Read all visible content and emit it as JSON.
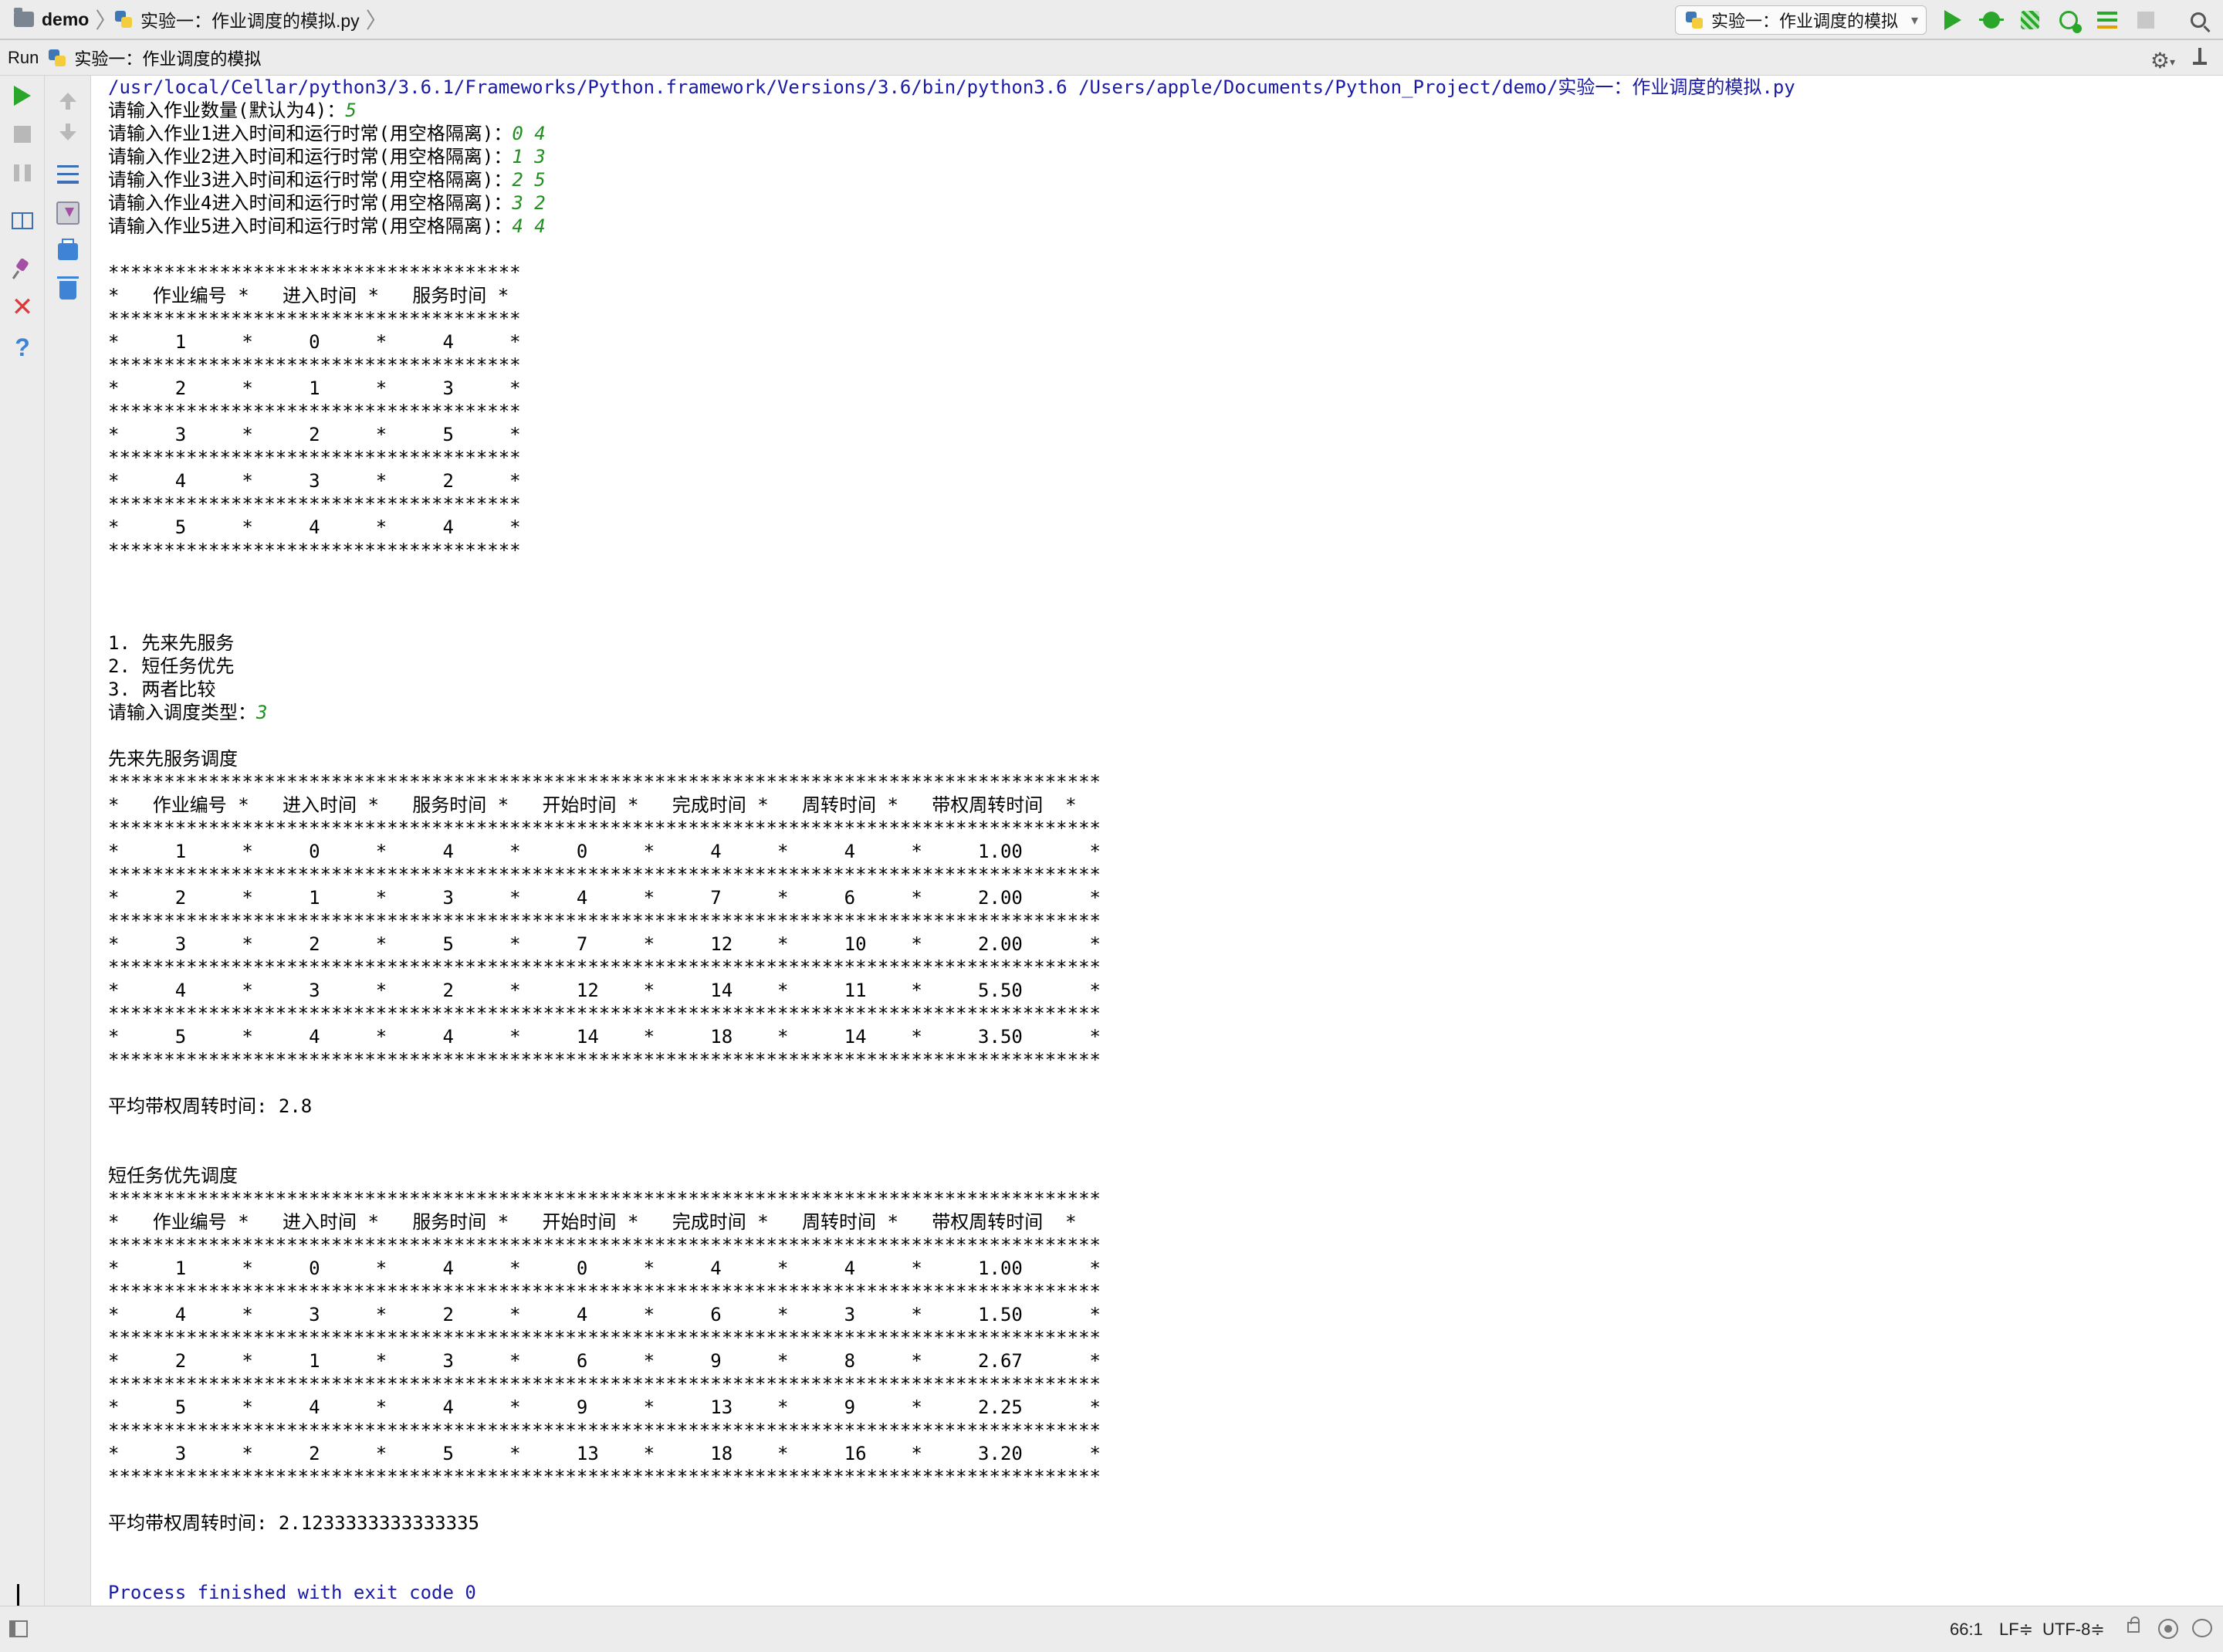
{
  "navbar": {
    "project": "demo",
    "file": "实验一：作业调度的模拟.py",
    "run_config": "实验一：作业调度的模拟"
  },
  "run_panel": {
    "label": "Run",
    "config": "实验一：作业调度的模拟"
  },
  "icons": {
    "toolbar": [
      "run-icon",
      "debug-icon",
      "coverage-icon",
      "profile-icon",
      "concurrency-icon",
      "stop-icon",
      "search-icon"
    ],
    "gutter_left": [
      "rerun-icon",
      "stop-icon",
      "pause-icon",
      "restore-layout-icon",
      "pin-tab-icon",
      "close-icon",
      "help-icon"
    ],
    "gutter_right": [
      "up-arrow-icon",
      "down-arrow-icon",
      "soft-wrap-icon",
      "scroll-to-end-icon",
      "print-icon",
      "trash-icon"
    ],
    "colors": {
      "run_green": "#2aa62a",
      "stdin_green": "#1f8f1f",
      "command_blue": "#1a1aa6"
    }
  },
  "console": {
    "lines": [
      {
        "type": "cmd",
        "text": "/usr/local/Cellar/python3/3.6.1/Frameworks/Python.framework/Versions/3.6/bin/python3.6 /Users/apple/Documents/Python_Project/demo/实验一：作业调度的模拟.py"
      },
      {
        "type": "prompt",
        "text": "请输入作业数量(默认为4)：",
        "input": "5"
      },
      {
        "type": "prompt",
        "text": "请输入作业1进入时间和运行时常(用空格隔离)：",
        "input": "0 4"
      },
      {
        "type": "prompt",
        "text": "请输入作业2进入时间和运行时常(用空格隔离)：",
        "input": "1 3"
      },
      {
        "type": "prompt",
        "text": "请输入作业3进入时间和运行时常(用空格隔离)：",
        "input": "2 5"
      },
      {
        "type": "prompt",
        "text": "请输入作业4进入时间和运行时常(用空格隔离)：",
        "input": "3 2"
      },
      {
        "type": "prompt",
        "text": "请输入作业5进入时间和运行时常(用空格隔离)：",
        "input": "4 4"
      },
      {
        "type": "out",
        "text": ""
      },
      {
        "type": "out",
        "text": "*************************************"
      },
      {
        "type": "out",
        "text": "*   作业编号 *   进入时间 *   服务时间 *"
      },
      {
        "type": "out",
        "text": "*************************************"
      },
      {
        "type": "out",
        "text": "*     1     *     0     *     4     *"
      },
      {
        "type": "out",
        "text": "*************************************"
      },
      {
        "type": "out",
        "text": "*     2     *     1     *     3     *"
      },
      {
        "type": "out",
        "text": "*************************************"
      },
      {
        "type": "out",
        "text": "*     3     *     2     *     5     *"
      },
      {
        "type": "out",
        "text": "*************************************"
      },
      {
        "type": "out",
        "text": "*     4     *     3     *     2     *"
      },
      {
        "type": "out",
        "text": "*************************************"
      },
      {
        "type": "out",
        "text": "*     5     *     4     *     4     *"
      },
      {
        "type": "out",
        "text": "*************************************"
      },
      {
        "type": "out",
        "text": ""
      },
      {
        "type": "out",
        "text": ""
      },
      {
        "type": "out",
        "text": ""
      },
      {
        "type": "out",
        "text": "1. 先来先服务"
      },
      {
        "type": "out",
        "text": "2. 短任务优先"
      },
      {
        "type": "out",
        "text": "3. 两者比较"
      },
      {
        "type": "prompt",
        "text": "请输入调度类型：",
        "input": "3"
      },
      {
        "type": "out",
        "text": ""
      },
      {
        "type": "out",
        "text": "先来先服务调度"
      },
      {
        "type": "out",
        "text": "*****************************************************************************************"
      },
      {
        "type": "out",
        "text": "*   作业编号 *   进入时间 *   服务时间 *   开始时间 *   完成时间 *   周转时间 *   带权周转时间  *"
      },
      {
        "type": "out",
        "text": "*****************************************************************************************"
      },
      {
        "type": "out",
        "text": "*     1     *     0     *     4     *     0     *     4     *     4     *     1.00      *"
      },
      {
        "type": "out",
        "text": "*****************************************************************************************"
      },
      {
        "type": "out",
        "text": "*     2     *     1     *     3     *     4     *     7     *     6     *     2.00      *"
      },
      {
        "type": "out",
        "text": "*****************************************************************************************"
      },
      {
        "type": "out",
        "text": "*     3     *     2     *     5     *     7     *     12    *     10    *     2.00      *"
      },
      {
        "type": "out",
        "text": "*****************************************************************************************"
      },
      {
        "type": "out",
        "text": "*     4     *     3     *     2     *     12    *     14    *     11    *     5.50      *"
      },
      {
        "type": "out",
        "text": "*****************************************************************************************"
      },
      {
        "type": "out",
        "text": "*     5     *     4     *     4     *     14    *     18    *     14    *     3.50      *"
      },
      {
        "type": "out",
        "text": "*****************************************************************************************"
      },
      {
        "type": "out",
        "text": ""
      },
      {
        "type": "out",
        "text": "平均带权周转时间: 2.8"
      },
      {
        "type": "out",
        "text": ""
      },
      {
        "type": "out",
        "text": ""
      },
      {
        "type": "out",
        "text": "短任务优先调度"
      },
      {
        "type": "out",
        "text": "*****************************************************************************************"
      },
      {
        "type": "out",
        "text": "*   作业编号 *   进入时间 *   服务时间 *   开始时间 *   完成时间 *   周转时间 *   带权周转时间  *"
      },
      {
        "type": "out",
        "text": "*****************************************************************************************"
      },
      {
        "type": "out",
        "text": "*     1     *     0     *     4     *     0     *     4     *     4     *     1.00      *"
      },
      {
        "type": "out",
        "text": "*****************************************************************************************"
      },
      {
        "type": "out",
        "text": "*     4     *     3     *     2     *     4     *     6     *     3     *     1.50      *"
      },
      {
        "type": "out",
        "text": "*****************************************************************************************"
      },
      {
        "type": "out",
        "text": "*     2     *     1     *     3     *     6     *     9     *     8     *     2.67      *"
      },
      {
        "type": "out",
        "text": "*****************************************************************************************"
      },
      {
        "type": "out",
        "text": "*     5     *     4     *     4     *     9     *     13    *     9     *     2.25      *"
      },
      {
        "type": "out",
        "text": "*****************************************************************************************"
      },
      {
        "type": "out",
        "text": "*     3     *     2     *     5     *     13    *     18    *     16    *     3.20      *"
      },
      {
        "type": "out",
        "text": "*****************************************************************************************"
      },
      {
        "type": "out",
        "text": ""
      },
      {
        "type": "out",
        "text": "平均带权周转时间: 2.1233333333333335"
      },
      {
        "type": "out",
        "text": ""
      },
      {
        "type": "out",
        "text": ""
      },
      {
        "type": "exit",
        "text": "Process finished with exit code 0"
      }
    ]
  },
  "status": {
    "position": "66:1",
    "line_separator": "LF≑",
    "encoding": "UTF-8≑"
  }
}
